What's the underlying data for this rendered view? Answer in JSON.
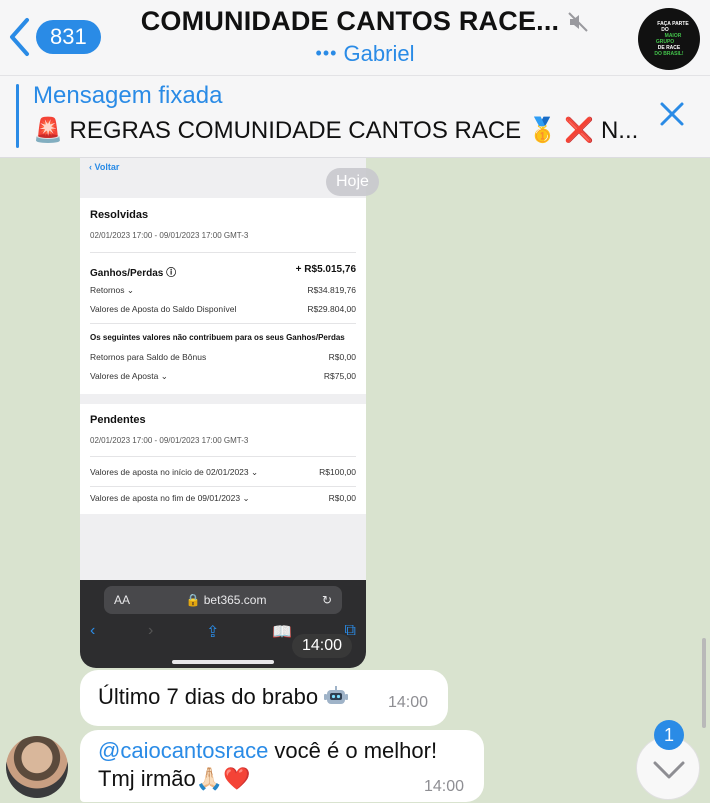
{
  "header": {
    "back_count": "831",
    "title": "COMUNIDADE CANTOS RACE...",
    "subtitle_prefix": "•••",
    "subtitle": "Gabriel",
    "group_avatar_text": [
      "FAÇA PARTE DO",
      "MAIOR GRUPO",
      "DE RACE",
      "DO BRASIL!"
    ]
  },
  "pinned": {
    "label": "Mensagem fixada",
    "text": "🚨 REGRAS COMUNIDADE CANTOS RACE 🥇 ❌ N..."
  },
  "chat": {
    "date_pill": "Hoje",
    "screenshot": {
      "nav_back": "‹ Voltar",
      "resolved_title": "Resolvidas",
      "resolved_range": "02/01/2023 17:00 - 09/01/2023 17:00 GMT-3",
      "gains_label": "Ganhos/Perdas ⓘ",
      "gains_value": "+ R$5.015,76",
      "rows1": [
        {
          "label": "Retornos ⌄",
          "value": "R$34.819,76"
        },
        {
          "label": "Valores de Aposta do Saldo Disponível",
          "value": "R$29.804,00"
        }
      ],
      "note": "Os seguintes valores não contribuem para os seus Ganhos/Perdas",
      "rows2": [
        {
          "label": "Retornos para Saldo de Bônus",
          "value": "R$0,00"
        },
        {
          "label": "Valores de Aposta ⌄",
          "value": "R$75,00"
        }
      ],
      "pending_title": "Pendentes",
      "pending_range": "02/01/2023 17:00 - 09/01/2023 17:00 GMT-3",
      "rows3": [
        {
          "label": "Valores de aposta no início de 02/01/2023 ⌄",
          "value": "R$100,00"
        },
        {
          "label": "Valores de aposta no fim de 09/01/2023 ⌄",
          "value": "R$0,00"
        }
      ],
      "url_aa": "AA",
      "url": "🔒 bet365.com",
      "reload": "↻",
      "safari_icons": [
        "‹",
        "›",
        "⇪",
        "📖",
        "⧉"
      ],
      "time": "14:00"
    },
    "messages": [
      {
        "text": "Último 7 dias do brabo",
        "time": "14:00"
      },
      {
        "mention": "@caiocantosrace",
        "text_rest": " você é o melhor!",
        "line2": "Tmj irmão🙏🏻❤️",
        "time": "14:00"
      }
    ],
    "unread_count": "1"
  },
  "colors": {
    "accent": "#2a8be6",
    "chat_bg": "#d9e3cf"
  }
}
